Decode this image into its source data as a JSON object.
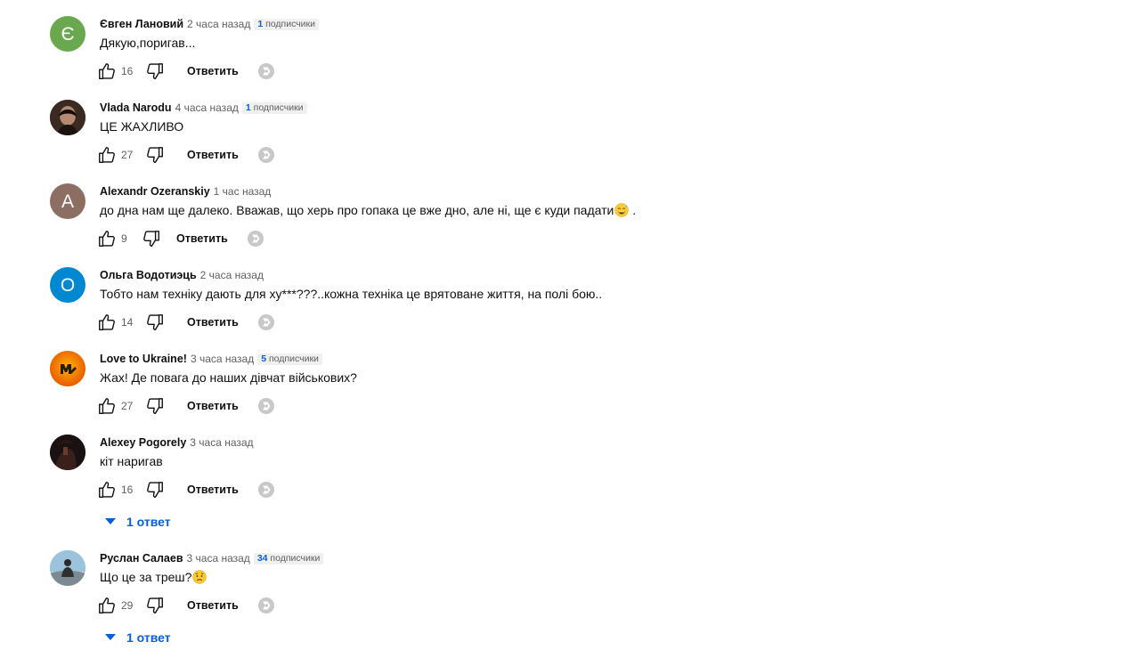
{
  "ui": {
    "reply_label": "Ответить"
  },
  "icons": {
    "like": "thumb-up-icon",
    "dislike": "thumb-down-icon",
    "thanks": "super-thanks-icon",
    "expand": "caret-down-icon"
  },
  "colors": {
    "link": "#065fd4",
    "muted": "#606060",
    "badge_bg": "#f0f0f0"
  },
  "comments": [
    {
      "author": "Євген Лановий",
      "time": "2 часа назад",
      "subs_count": "1",
      "subs_label": "подписчики",
      "text": "Дякую,поригав...",
      "likes": "16",
      "avatar": {
        "type": "initial",
        "letter": "Є",
        "color": "#6aa84f"
      }
    },
    {
      "author": "Vlada Narodu",
      "time": "4 часа назад",
      "subs_count": "1",
      "subs_label": "подписчики",
      "text": "ЦЕ ЖАХЛИВО",
      "likes": "27",
      "avatar": {
        "type": "photo",
        "color": "#3a2a22"
      }
    },
    {
      "author": "Alexandr Ozeranskiy",
      "time": "1 час назад",
      "text": "до дна нам ще далеко. Вважав, що херь про гопака це вже дно, але ні, ще є куди падати",
      "text_end": ".",
      "emoji": "smiling-sweat-face-emoji",
      "likes": "9",
      "avatar": {
        "type": "initial",
        "letter": "A",
        "color": "#8d6e63"
      }
    },
    {
      "author": "Ольга Водотиэць",
      "time": "2 часа назад",
      "text": "Тобто нам техніку дають для ху***???..кожна техніка це врятоване життя, на полі бою..",
      "likes": "14",
      "avatar": {
        "type": "initial",
        "letter": "O",
        "color": "#0288d1"
      }
    },
    {
      "author": "Love to Ukraine!",
      "time": "3 часа назад",
      "subs_count": "5",
      "subs_label": "подписчики",
      "text": "Жах! Де повага до наших дівчат військових?",
      "likes": "27",
      "avatar": {
        "type": "logo",
        "color": "#f57c00"
      }
    },
    {
      "author": "Alexey Pogorely",
      "time": "3 часа назад",
      "text": "кіт наригав",
      "likes": "16",
      "replies": "1 ответ",
      "avatar": {
        "type": "photo",
        "color": "#1a1212"
      }
    },
    {
      "author": "Руслан Салаев",
      "time": "3 часа назад",
      "subs_count": "34",
      "subs_label": "подписчики",
      "text": "Що це за треш?",
      "emoji": "worried-face-emoji",
      "likes": "29",
      "replies": "1 ответ",
      "avatar": {
        "type": "photo",
        "color": "#8fb6d1"
      }
    }
  ]
}
